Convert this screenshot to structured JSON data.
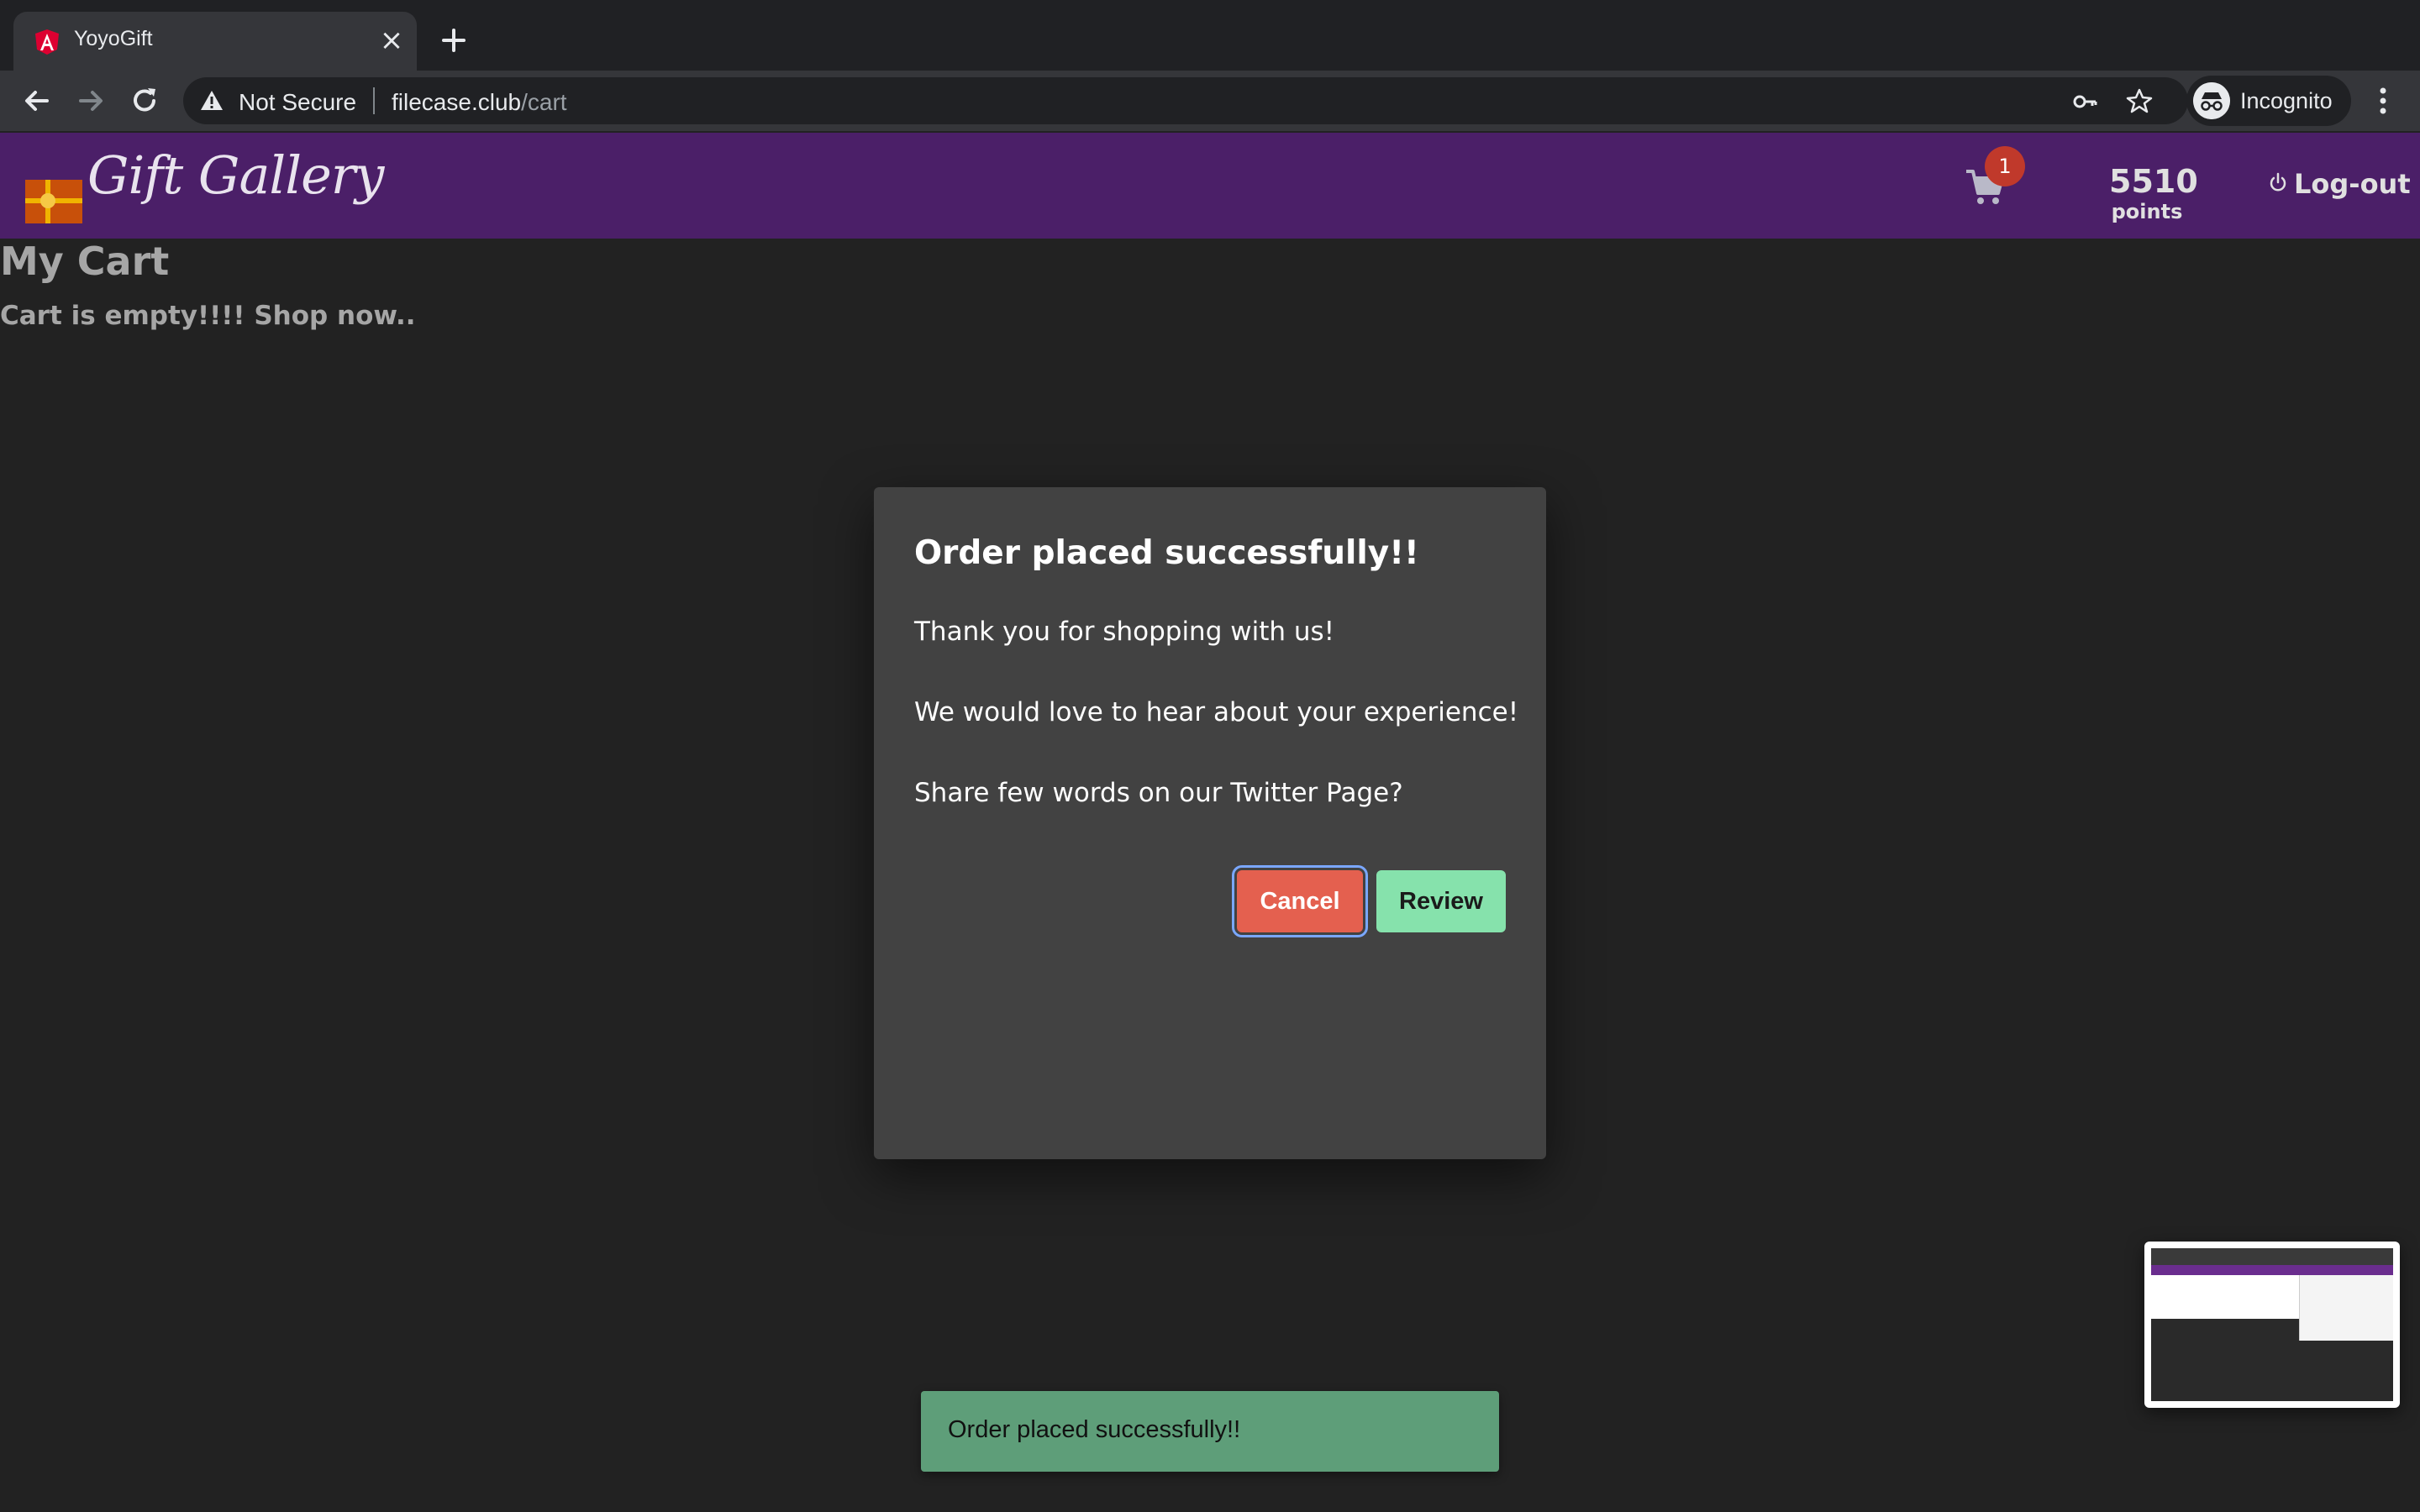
{
  "browser": {
    "tab_title": "YoyoGift",
    "security_label": "Not Secure",
    "url_host": "filecase.club",
    "url_path": "/cart",
    "profile_label": "Incognito"
  },
  "header": {
    "logo_text": "Gift Gallery",
    "cart_count": "1",
    "points_value": "5510",
    "points_label": "points",
    "logout_label": "Log-out",
    "brand_color": "#4b1f68"
  },
  "page": {
    "title": "My Cart",
    "empty_message": "Cart is empty!!!! Shop now.."
  },
  "modal": {
    "title": "Order placed successfully!!",
    "lines": [
      "Thank you for shopping with us!",
      "We would love to hear about your experience!",
      "Share few words on our Twitter Page?"
    ],
    "cancel_label": "Cancel",
    "review_label": "Review",
    "cancel_color": "#e4604f",
    "review_color": "#86e2ac"
  },
  "snackbar": {
    "message": "Order placed successfully!!",
    "color": "#5e9e79"
  },
  "icons": [
    "angular-favicon-icon",
    "close-icon",
    "plus-icon",
    "back-arrow-icon",
    "forward-arrow-icon",
    "reload-icon",
    "warning-icon",
    "key-icon",
    "star-icon",
    "incognito-icon",
    "kebab-menu-icon",
    "cart-icon",
    "power-icon"
  ]
}
